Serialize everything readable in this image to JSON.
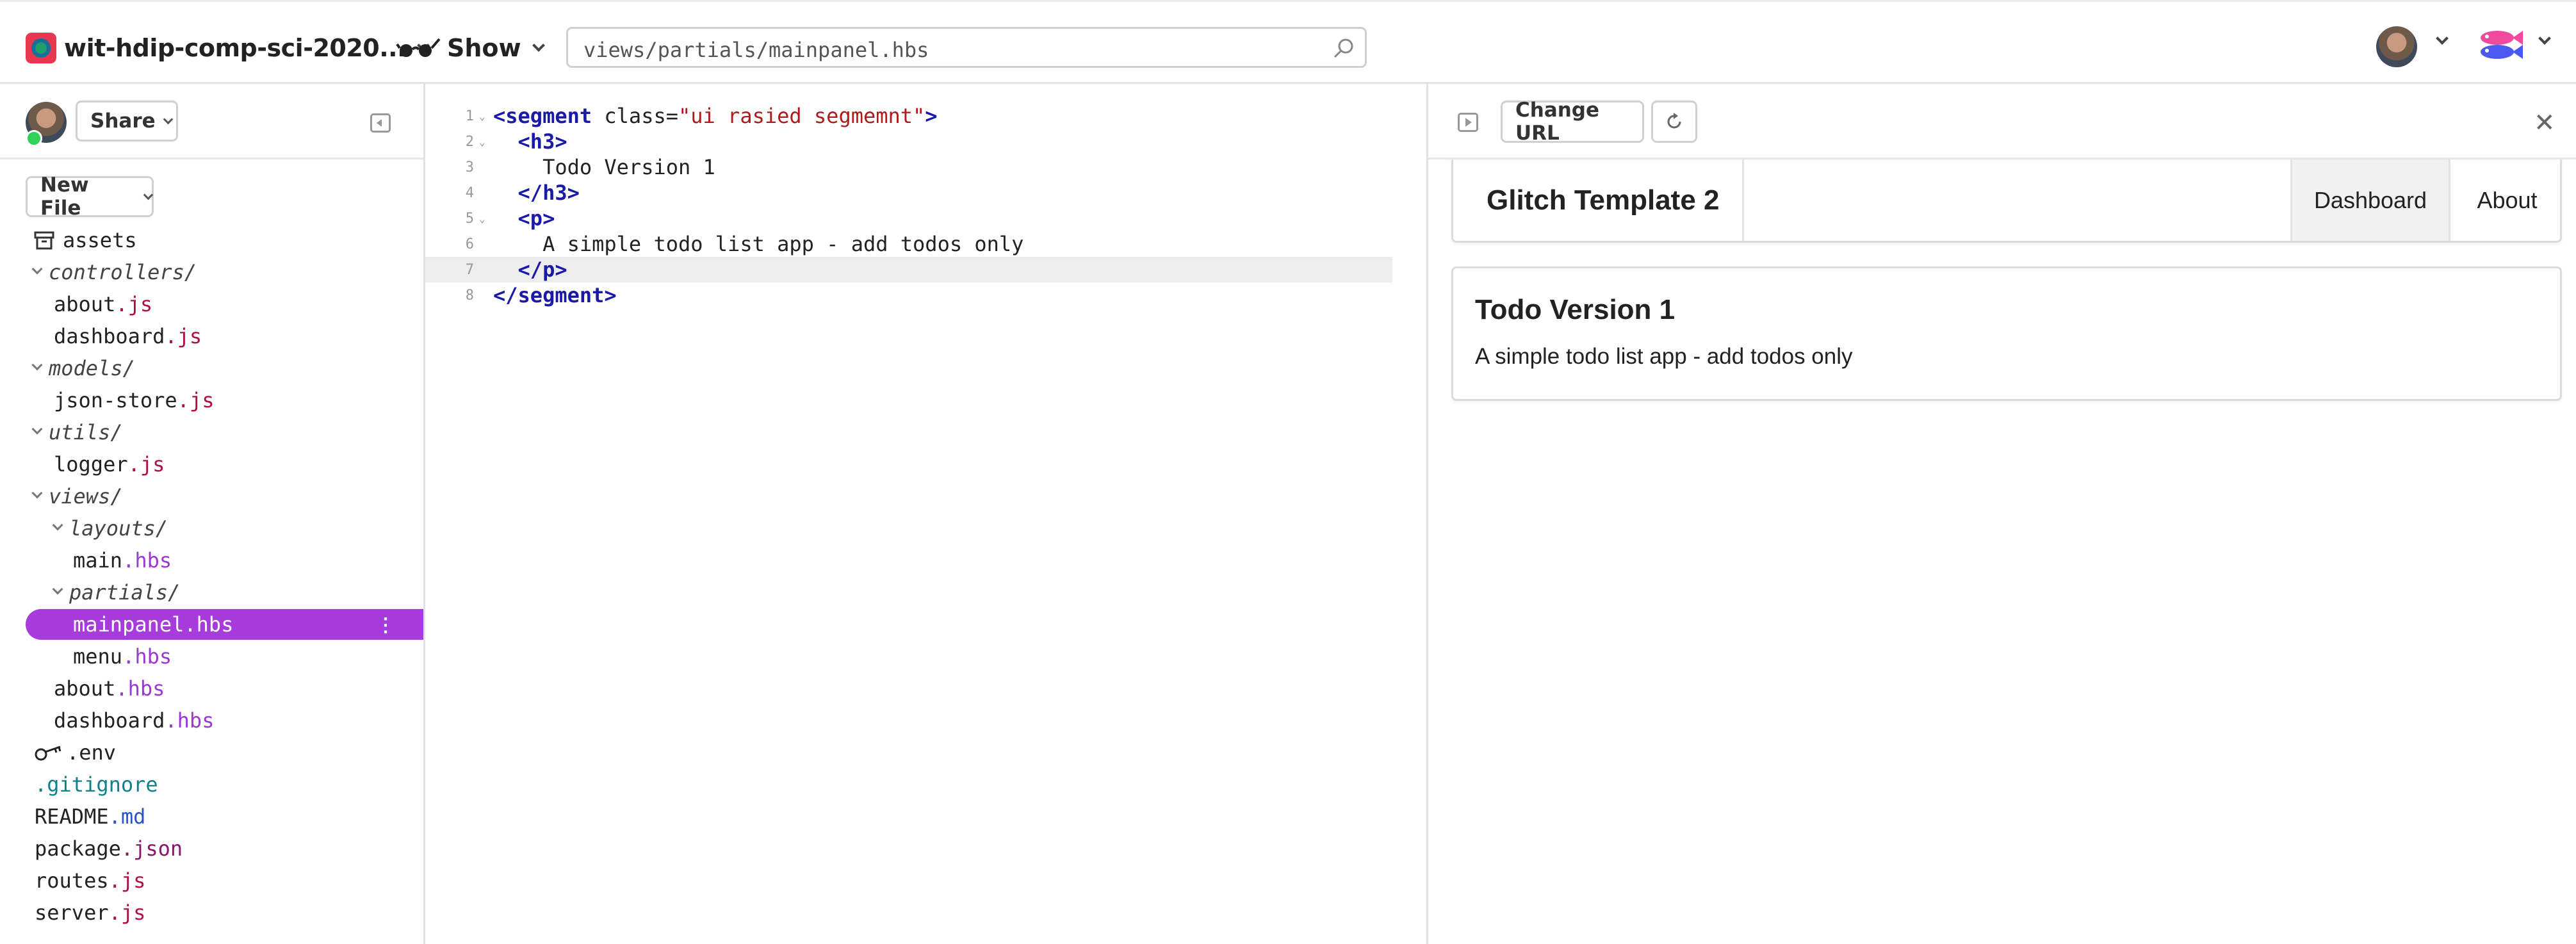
{
  "header": {
    "project_name": "wit-hdip-comp-sci-2020...",
    "show_label": "Show",
    "url_value": "views/partials/mainpanel.hbs"
  },
  "sidebar": {
    "share_label": "Share",
    "new_file_label": "New File",
    "tree": [
      {
        "name": "assets",
        "ext": "",
        "type": "assets"
      },
      {
        "name": "controllers/",
        "ext": "",
        "type": "dir"
      },
      {
        "name": "about",
        "ext": ".js",
        "type": "file"
      },
      {
        "name": "dashboard",
        "ext": ".js",
        "type": "file"
      },
      {
        "name": "models/",
        "ext": "",
        "type": "dir"
      },
      {
        "name": "json-store",
        "ext": ".js",
        "type": "file"
      },
      {
        "name": "utils/",
        "ext": "",
        "type": "dir"
      },
      {
        "name": "logger",
        "ext": ".js",
        "type": "file"
      },
      {
        "name": "views/",
        "ext": "",
        "type": "dir"
      },
      {
        "name": "layouts/",
        "ext": "",
        "type": "dir"
      },
      {
        "name": "main",
        "ext": ".hbs",
        "type": "file"
      },
      {
        "name": "partials/",
        "ext": "",
        "type": "dir"
      },
      {
        "name": "mainpanel",
        "ext": ".hbs",
        "type": "selected"
      },
      {
        "name": "menu",
        "ext": ".hbs",
        "type": "file"
      },
      {
        "name": "about",
        "ext": ".hbs",
        "type": "file"
      },
      {
        "name": "dashboard",
        "ext": ".hbs",
        "type": "file"
      },
      {
        "name": ".env",
        "ext": "",
        "type": "env"
      },
      {
        "name": ".gitignore",
        "ext": "",
        "type": "dotfile"
      },
      {
        "name": "README",
        "ext": ".md",
        "type": "file"
      },
      {
        "name": "package",
        "ext": ".json",
        "type": "file"
      },
      {
        "name": "routes",
        "ext": ".js",
        "type": "file"
      },
      {
        "name": "server",
        "ext": ".js",
        "type": "file"
      }
    ]
  },
  "editor": {
    "line_numbers": [
      "1",
      "2",
      "3",
      "4",
      "5",
      "6",
      "7",
      "8"
    ],
    "lines": [
      {
        "tag_open": "<segment",
        "attr": " class=",
        "str": "\"ui rasied segmemnt\"",
        "tag_close": ">"
      },
      {
        "tag_open": "<h3>"
      },
      {
        "text": "Todo Version 1"
      },
      {
        "tag_open": "</h3>"
      },
      {
        "tag_open": "<p>"
      },
      {
        "text": "A simple todo list app - add todos only"
      },
      {
        "tag_open": "</p>"
      },
      {
        "tag_open": "</segment>"
      }
    ]
  },
  "preview": {
    "change_url_label": "Change URL",
    "app_brand": "Glitch Template 2",
    "nav_items": [
      "Dashboard",
      "About"
    ],
    "segment_title": "Todo Version 1",
    "segment_text": "A simple todo list app - add todos only"
  },
  "colors": {
    "selected_file_bg": "#a83bdc",
    "js_ext": "#b0104a",
    "hbs_ext": "#9b37d3",
    "md_ext": "#2553c9",
    "json_ext": "#8a1566",
    "tag": "#1a1aa6",
    "string": "#b01a1a"
  }
}
